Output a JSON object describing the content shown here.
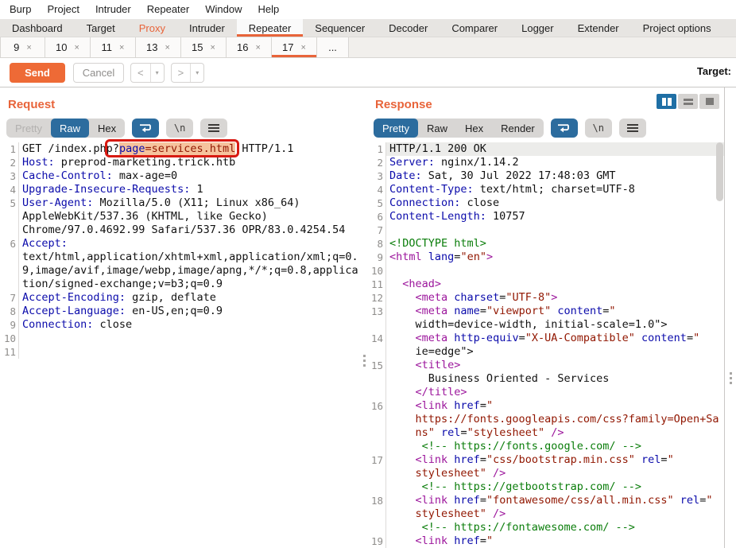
{
  "menu": {
    "items": [
      "Burp",
      "Project",
      "Intruder",
      "Repeater",
      "Window",
      "Help"
    ]
  },
  "main_tabs": {
    "items": [
      {
        "label": "Dashboard"
      },
      {
        "label": "Target"
      },
      {
        "label": "Proxy",
        "accent": true
      },
      {
        "label": "Intruder"
      },
      {
        "label": "Repeater",
        "selected": true
      },
      {
        "label": "Sequencer"
      },
      {
        "label": "Decoder"
      },
      {
        "label": "Comparer"
      },
      {
        "label": "Logger"
      },
      {
        "label": "Extender"
      },
      {
        "label": "Project options"
      }
    ]
  },
  "repeater_tabs": {
    "close_glyph": "×",
    "items": [
      {
        "label": "9"
      },
      {
        "label": "10"
      },
      {
        "label": "11"
      },
      {
        "label": "13"
      },
      {
        "label": "15"
      },
      {
        "label": "16"
      },
      {
        "label": "17",
        "selected": true
      }
    ],
    "overflow_label": "..."
  },
  "toolbar": {
    "send_label": "Send",
    "cancel_label": "Cancel",
    "back_glyph": "<",
    "forward_glyph": ">",
    "dropdown_glyph": "▾",
    "target_label": "Target:"
  },
  "view_toggle": {
    "buttons": [
      {
        "name": "split-columns-view-button",
        "selected": true
      },
      {
        "name": "split-rows-view-button",
        "selected": false
      },
      {
        "name": "single-pane-view-button",
        "selected": false
      }
    ]
  },
  "colors": {
    "accent_orange": "#e8643a",
    "selected_blue": "#2c6c9e",
    "highlight_salmon": "#f6c39d",
    "annotation_red": "#d81a12",
    "header_name_blue": "#0b0bab",
    "value_dark_red": "#911600",
    "tag_magenta": "#9c169c",
    "comment_green": "#0a7d0a"
  },
  "request": {
    "title": "Request",
    "tabs": [
      {
        "label": "Pretty",
        "disabled": true
      },
      {
        "label": "Raw",
        "selected": true
      },
      {
        "label": "Hex"
      }
    ],
    "newline_label": "\\n",
    "rows": [
      {
        "n": "1",
        "anno": [
          1,
          3
        ],
        "s": [
          [
            "GET /index.php",
            "d"
          ],
          [
            "?",
            "d"
          ],
          [
            "page",
            "b sel"
          ],
          [
            "=services.html",
            "r sel"
          ],
          [
            " HTTP/1.1",
            "d"
          ]
        ]
      },
      {
        "n": "2",
        "s": [
          [
            "Host:",
            "b"
          ],
          [
            " preprod-marketing.trick.htb",
            "d"
          ]
        ]
      },
      {
        "n": "3",
        "s": [
          [
            "Cache-Control:",
            "b"
          ],
          [
            " max-age=0",
            "d"
          ]
        ]
      },
      {
        "n": "4",
        "s": [
          [
            "Upgrade-Insecure-Requests:",
            "b"
          ],
          [
            " 1",
            "d"
          ]
        ]
      },
      {
        "n": "5",
        "s": [
          [
            "User-Agent:",
            "b"
          ],
          [
            " Mozilla/5.0 (X11; Linux x86_64)",
            "d"
          ]
        ]
      },
      {
        "n": "",
        "s": [
          [
            "AppleWebKit/537.36 (KHTML, like Gecko)",
            "d"
          ]
        ]
      },
      {
        "n": "",
        "s": [
          [
            "Chrome/97.0.4692.99 Safari/537.36 OPR/83.0.4254.54",
            "d"
          ]
        ]
      },
      {
        "n": "6",
        "s": [
          [
            "Accept:",
            "b"
          ]
        ]
      },
      {
        "n": "",
        "s": [
          [
            "text/html,application/xhtml+xml,application/xml;q=0.",
            "d"
          ]
        ]
      },
      {
        "n": "",
        "s": [
          [
            "9,image/avif,image/webp,image/apng,*/*;q=0.8,applica",
            "d"
          ]
        ]
      },
      {
        "n": "",
        "s": [
          [
            "tion/signed-exchange;v=b3;q=0.9",
            "d"
          ]
        ]
      },
      {
        "n": "7",
        "s": [
          [
            "Accept-Encoding:",
            "b"
          ],
          [
            " gzip, deflate",
            "d"
          ]
        ]
      },
      {
        "n": "8",
        "s": [
          [
            "Accept-Language:",
            "b"
          ],
          [
            " en-US,en;q=0.9",
            "d"
          ]
        ]
      },
      {
        "n": "9",
        "s": [
          [
            "Connection:",
            "b"
          ],
          [
            " close",
            "d"
          ]
        ]
      },
      {
        "n": "10",
        "s": []
      },
      {
        "n": "11",
        "s": []
      }
    ]
  },
  "response": {
    "title": "Response",
    "tabs": [
      {
        "label": "Pretty",
        "selected": true
      },
      {
        "label": "Raw"
      },
      {
        "label": "Hex"
      },
      {
        "label": "Render"
      }
    ],
    "newline_label": "\\n",
    "rows": [
      {
        "n": "1",
        "cursor": true,
        "s": [
          [
            "HTTP/1.1 200 OK",
            "d"
          ]
        ]
      },
      {
        "n": "2",
        "s": [
          [
            "Server:",
            "b"
          ],
          [
            " nginx/1.14.2",
            "d"
          ]
        ]
      },
      {
        "n": "3",
        "s": [
          [
            "Date:",
            "b"
          ],
          [
            " Sat, 30 Jul 2022 17:48:03 GMT",
            "d"
          ]
        ]
      },
      {
        "n": "4",
        "s": [
          [
            "Content-Type:",
            "b"
          ],
          [
            " text/html; charset=UTF-8",
            "d"
          ]
        ]
      },
      {
        "n": "5",
        "s": [
          [
            "Connection:",
            "b"
          ],
          [
            " close",
            "d"
          ]
        ]
      },
      {
        "n": "6",
        "s": [
          [
            "Content-Length:",
            "b"
          ],
          [
            " 10757",
            "d"
          ]
        ]
      },
      {
        "n": "7",
        "s": []
      },
      {
        "n": "8",
        "s": [
          [
            "<!DOCTYPE html>",
            "g"
          ]
        ]
      },
      {
        "n": "9",
        "s": [
          [
            "<html",
            "m"
          ],
          [
            " ",
            "d"
          ],
          [
            "lang",
            "b"
          ],
          [
            "=",
            "d"
          ],
          [
            "\"en\"",
            "r"
          ],
          [
            ">",
            "m"
          ]
        ]
      },
      {
        "n": "10",
        "s": []
      },
      {
        "n": "11",
        "s": [
          [
            "  ",
            "d"
          ],
          [
            "<head>",
            "m"
          ]
        ]
      },
      {
        "n": "12",
        "s": [
          [
            "    ",
            "d"
          ],
          [
            "<meta",
            "m"
          ],
          [
            " ",
            "d"
          ],
          [
            "charset",
            "b"
          ],
          [
            "=",
            "d"
          ],
          [
            "\"UTF-8\"",
            "r"
          ],
          [
            ">",
            "m"
          ]
        ]
      },
      {
        "n": "13",
        "s": [
          [
            "    ",
            "d"
          ],
          [
            "<meta",
            "m"
          ],
          [
            " ",
            "d"
          ],
          [
            "name",
            "b"
          ],
          [
            "=",
            "d"
          ],
          [
            "\"viewport\"",
            "r"
          ],
          [
            " ",
            "d"
          ],
          [
            "content",
            "b"
          ],
          [
            "=",
            "d"
          ],
          [
            "\"",
            "r"
          ]
        ]
      },
      {
        "n": "",
        "s": [
          [
            "    width=device-width, initial-scale=1.0\">",
            "d"
          ]
        ]
      },
      {
        "n": "14",
        "s": [
          [
            "    ",
            "d"
          ],
          [
            "<meta",
            "m"
          ],
          [
            " ",
            "d"
          ],
          [
            "http-equiv",
            "b"
          ],
          [
            "=",
            "d"
          ],
          [
            "\"X-UA-Compatible\"",
            "r"
          ],
          [
            " ",
            "d"
          ],
          [
            "content",
            "b"
          ],
          [
            "=",
            "d"
          ],
          [
            "\"",
            "r"
          ]
        ]
      },
      {
        "n": "",
        "s": [
          [
            "    ie=edge\">",
            "d"
          ]
        ]
      },
      {
        "n": "15",
        "s": [
          [
            "    ",
            "d"
          ],
          [
            "<title>",
            "m"
          ]
        ]
      },
      {
        "n": "",
        "s": [
          [
            "      Business Oriented - Services",
            "d"
          ]
        ]
      },
      {
        "n": "",
        "s": [
          [
            "    ",
            "d"
          ],
          [
            "</title>",
            "m"
          ]
        ]
      },
      {
        "n": "16",
        "s": [
          [
            "    ",
            "d"
          ],
          [
            "<link",
            "m"
          ],
          [
            " ",
            "d"
          ],
          [
            "href",
            "b"
          ],
          [
            "=",
            "d"
          ],
          [
            "\"",
            "r"
          ]
        ]
      },
      {
        "n": "",
        "s": [
          [
            "    ",
            "d"
          ],
          [
            "https://fonts.googleapis.com/css?family=Open+Sa",
            "r"
          ]
        ]
      },
      {
        "n": "",
        "s": [
          [
            "    ",
            "d"
          ],
          [
            "ns\"",
            "r"
          ],
          [
            " ",
            "d"
          ],
          [
            "rel",
            "b"
          ],
          [
            "=",
            "d"
          ],
          [
            "\"stylesheet\"",
            "r"
          ],
          [
            " />",
            "m"
          ]
        ]
      },
      {
        "n": "",
        "s": [
          [
            "     ",
            "d"
          ],
          [
            "<!-- https://fonts.google.com/ -->",
            "g"
          ]
        ]
      },
      {
        "n": "17",
        "s": [
          [
            "    ",
            "d"
          ],
          [
            "<link",
            "m"
          ],
          [
            " ",
            "d"
          ],
          [
            "href",
            "b"
          ],
          [
            "=",
            "d"
          ],
          [
            "\"css/bootstrap.min.css\"",
            "r"
          ],
          [
            " ",
            "d"
          ],
          [
            "rel",
            "b"
          ],
          [
            "=",
            "d"
          ],
          [
            "\"",
            "r"
          ]
        ]
      },
      {
        "n": "",
        "s": [
          [
            "    ",
            "d"
          ],
          [
            "stylesheet\"",
            "r"
          ],
          [
            " />",
            "m"
          ]
        ]
      },
      {
        "n": "",
        "s": [
          [
            "     ",
            "d"
          ],
          [
            "<!-- https://getbootstrap.com/ -->",
            "g"
          ]
        ]
      },
      {
        "n": "18",
        "s": [
          [
            "    ",
            "d"
          ],
          [
            "<link",
            "m"
          ],
          [
            " ",
            "d"
          ],
          [
            "href",
            "b"
          ],
          [
            "=",
            "d"
          ],
          [
            "\"fontawesome/css/all.min.css\"",
            "r"
          ],
          [
            " ",
            "d"
          ],
          [
            "rel",
            "b"
          ],
          [
            "=",
            "d"
          ],
          [
            "\"",
            "r"
          ]
        ]
      },
      {
        "n": "",
        "s": [
          [
            "    ",
            "d"
          ],
          [
            "stylesheet\"",
            "r"
          ],
          [
            " />",
            "m"
          ]
        ]
      },
      {
        "n": "",
        "s": [
          [
            "     ",
            "d"
          ],
          [
            "<!-- https://fontawesome.com/ -->",
            "g"
          ]
        ]
      },
      {
        "n": "19",
        "s": [
          [
            "    ",
            "d"
          ],
          [
            "<link",
            "m"
          ],
          [
            " ",
            "d"
          ],
          [
            "href",
            "b"
          ],
          [
            "=",
            "d"
          ],
          [
            "\"",
            "r"
          ]
        ]
      }
    ]
  }
}
